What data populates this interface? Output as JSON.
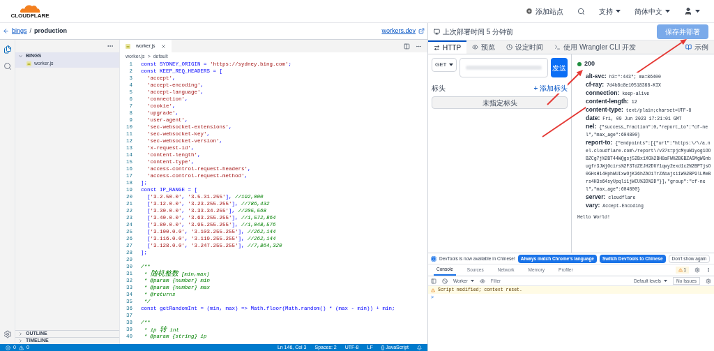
{
  "header": {
    "logo": "CLOUDFLARE",
    "nav": [
      {
        "kind": "add",
        "label": "添加站点"
      },
      {
        "kind": "search"
      },
      {
        "kind": "menu",
        "label": "支持"
      },
      {
        "kind": "menu",
        "label": "简体中文"
      },
      {
        "kind": "user"
      }
    ]
  },
  "breadcrumb": {
    "back": "bings",
    "separator": "/",
    "current": "production",
    "link": "workers.dev"
  },
  "explorer": {
    "folder": {
      "label": "BINGS",
      "expanded": true,
      "children": [
        {
          "label": "worker.js",
          "selected": true
        }
      ]
    },
    "sections": [
      {
        "label": "OUTLINE",
        "expanded": false
      },
      {
        "label": "TIMELINE",
        "expanded": false
      }
    ]
  },
  "editor": {
    "tab": {
      "label": "worker.js",
      "selected": true
    },
    "crumbs": [
      "worker.js",
      ">",
      "default"
    ],
    "lines": [
      {
        "n": "1",
        "code": "const SYDNEY_ORIGIN = 'https://sydney.bing.com';"
      },
      {
        "n": "2",
        "code": "const KEEP_REQ_HEADERS = ["
      },
      {
        "n": "3",
        "code": "  'accept',"
      },
      {
        "n": "4",
        "code": "  'accept-encoding',"
      },
      {
        "n": "5",
        "code": "  'accept-language',"
      },
      {
        "n": "6",
        "code": "  'connection',"
      },
      {
        "n": "7",
        "code": "  'cookie',"
      },
      {
        "n": "8",
        "code": "  'upgrade',"
      },
      {
        "n": "9",
        "code": "  'user-agent',"
      },
      {
        "n": "10",
        "code": "  'sec-websocket-extensions',"
      },
      {
        "n": "11",
        "code": "  'sec-websocket-key',"
      },
      {
        "n": "12",
        "code": "  'sec-websocket-version',"
      },
      {
        "n": "13",
        "code": "  'x-request-id',"
      },
      {
        "n": "14",
        "code": "  'content-length',"
      },
      {
        "n": "15",
        "code": "  'content-type',"
      },
      {
        "n": "16",
        "code": "  'access-control-request-headers',"
      },
      {
        "n": "17",
        "code": "  'access-control-request-method',"
      },
      {
        "n": "18",
        "code": "];"
      },
      {
        "n": "19",
        "code": "const IP_RANGE = ["
      },
      {
        "n": "20",
        "code": "  ['3.2.50.0', '3.5.31.255'], //192,000"
      },
      {
        "n": "21",
        "code": "  ['3.12.0.0', '3.23.255.255'], //786,432"
      },
      {
        "n": "22",
        "code": "  ['3.30.0.0', '3.33.34.255'], //205,568"
      },
      {
        "n": "23",
        "code": "  ['3.40.0.0', '3.63.255.255'], //1,572,864"
      },
      {
        "n": "24",
        "code": "  ['3.80.0.0', '3.95.255.255'], //1,048,576"
      },
      {
        "n": "25",
        "code": "  ['3.100.0.0', '3.103.255.255'], //262,144"
      },
      {
        "n": "26",
        "code": "  ['3.116.0.0', '3.119.255.255'], //262,144"
      },
      {
        "n": "27",
        "code": "  ['3.128.0.0', '3.247.255.255'], //7,864,320"
      },
      {
        "n": "28",
        "code": "];"
      },
      {
        "n": "29"
      },
      {
        "n": "30",
        "code": "/**"
      },
      {
        "n": "31",
        "code": " * 随机整数 [min,max)"
      },
      {
        "n": "32",
        "code": " * @param {number} min"
      },
      {
        "n": "33",
        "code": " * @param {number} max"
      },
      {
        "n": "34",
        "code": " * @returns"
      },
      {
        "n": "35",
        "code": " */"
      },
      {
        "n": "36",
        "code": "const getRandomInt = (min, max) => Math.floor(Math.random() * (max - min)) + min;"
      },
      {
        "n": "37"
      },
      {
        "n": "38",
        "code": "/**"
      },
      {
        "n": "39",
        "code": " * ip 转 int"
      },
      {
        "n": "40",
        "code": " * @param {string} ip"
      }
    ]
  },
  "status_bar": {
    "errors": "0",
    "warnings": "0",
    "items": [
      "Ln 146, Col 3",
      "Spaces: 2",
      "UTF-8",
      "LF",
      "{} JavaScript"
    ]
  },
  "deploy_bar": {
    "text": "上次部署时间 5 分钟前",
    "button": "保存并部署"
  },
  "tabs": [
    {
      "kind": "http",
      "label": "HTTP",
      "selected": true
    },
    {
      "kind": "preview",
      "label": "预览",
      "selected": false
    },
    {
      "kind": "schedule",
      "label": "设定时间",
      "selected": false
    },
    {
      "kind": "cli",
      "label": "使用 Wrangler CLI 开发",
      "selected": false
    }
  ],
  "examples": "示例",
  "request": {
    "method": "GET",
    "send": "发送",
    "headers_label": "标头",
    "add_header": "+ 添加标头",
    "no_headers": "未指定标头"
  },
  "response": {
    "status": "200",
    "status_ok": true,
    "headers": [
      {
        "name": "alt-svc:",
        "value": "h3=\":443\"; ma=86400"
      },
      {
        "name": "cf-ray:",
        "value": "7d4b6c8e10518368-KIX"
      },
      {
        "name": "connection:",
        "value": "keep-alive"
      },
      {
        "name": "content-length:",
        "value": "12"
      },
      {
        "name": "content-type:",
        "value": "text/plain;charset=UTF-8"
      },
      {
        "name": "date:",
        "value": "Fri, 09 Jun 2023 17:21:01 GMT"
      },
      {
        "name": "nel:",
        "value": "{\"success_fraction\":0,\"report_to\":\"cf-nel\",\"max_age\":604800}"
      },
      {
        "name": "report-to:",
        "value": "{\"endpoints\":[{\"url\":\"https:\\/\\/a.nel.cloudflare.com\\/report\\/v3?s=pjcMyuW1yog1OOBZCg7j%2BT44WQgsj52Bx1XG%2BH8aFW%2BGBZASMgWGnbugfr3JWjOcirs%2F3TdZEJH2DUY1qwy2exd1c2%2BPTjsO0GHsH14HphWUIxwOjK36hZAOiTrZAbajsi1W%2BP9lLMeBrs4H3s64syUpqli1jWCU%3D%3D\"}],\"group\":\"cf-nel\",\"max_age\":604800}"
      },
      {
        "name": "server:",
        "value": "cloudflare"
      },
      {
        "name": "vary:",
        "value": "Accept-Encoding"
      }
    ],
    "body": "Hello World!"
  },
  "devtools": {
    "notice": "DevTools is now available in Chinese!",
    "notice_buttons": [
      {
        "label": "Always match Chrome's language",
        "primary": true
      },
      {
        "label": "Switch DevTools to Chinese",
        "primary": true
      },
      {
        "label": "Don't show again",
        "primary": false
      }
    ],
    "tabs": [
      {
        "label": "Console",
        "selected": true
      },
      {
        "label": "Sources",
        "selected": false
      },
      {
        "label": "Network",
        "selected": false
      },
      {
        "label": "Memory",
        "selected": false
      },
      {
        "label": "Profiler",
        "selected": false
      }
    ],
    "warning_count": "1",
    "context": "Worker",
    "filter_placeholder": "Filter",
    "levels": "Default levels",
    "issues": "No Issues",
    "messages": [
      {
        "kind": "warning",
        "text": "Script modified; context reset."
      }
    ],
    "prompt": ">"
  }
}
